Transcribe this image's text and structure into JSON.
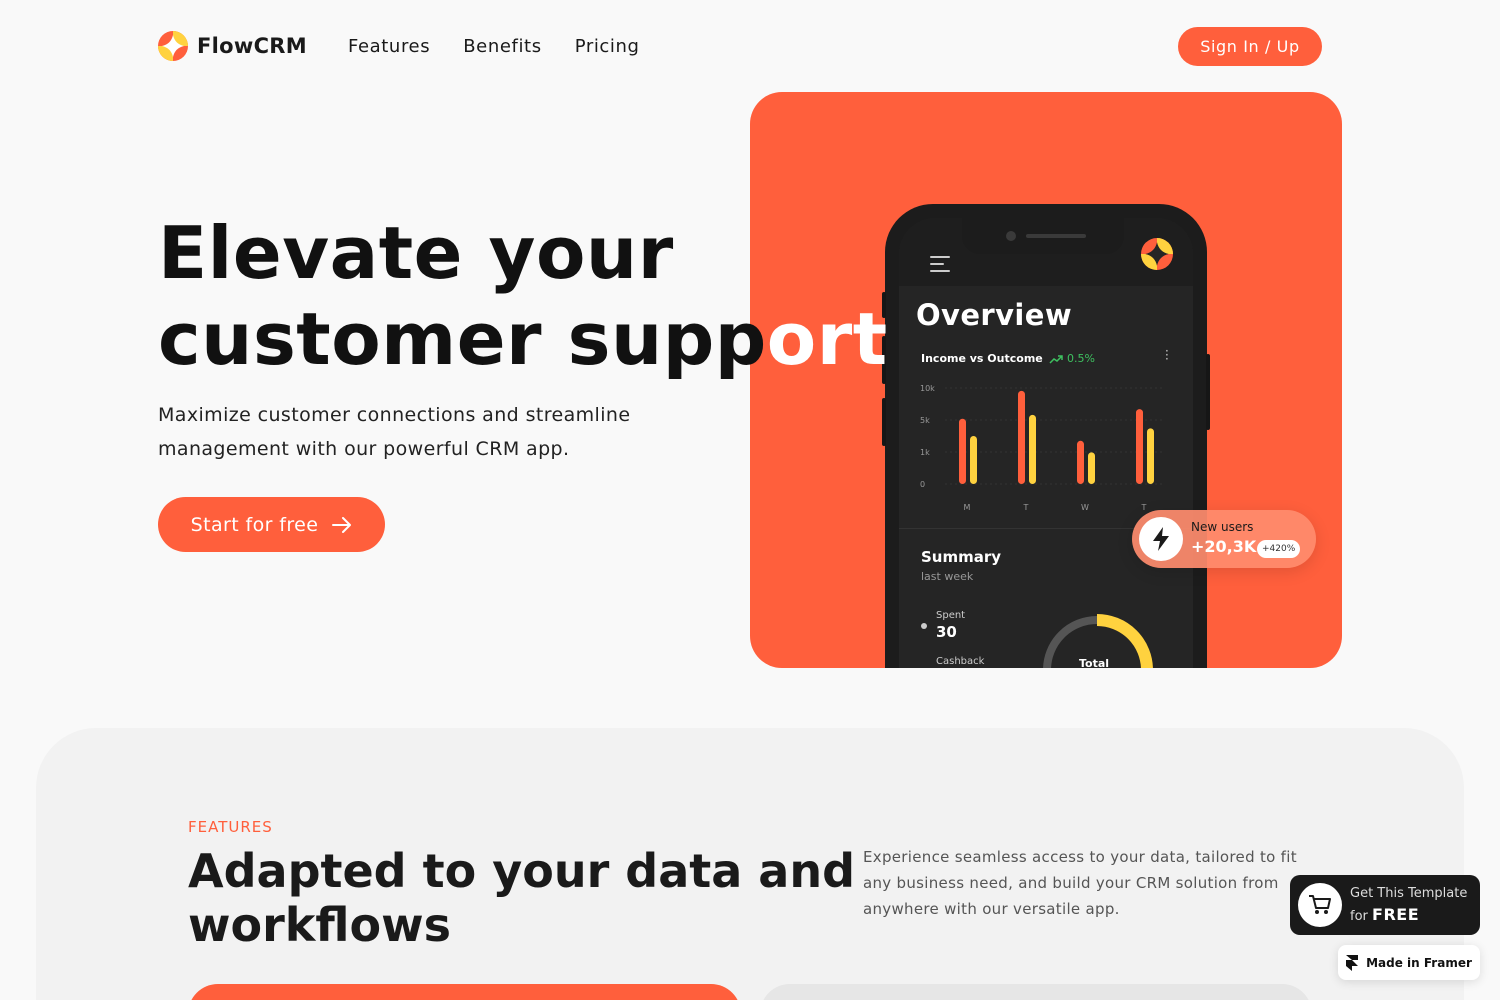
{
  "brand": {
    "name": "FlowCRM",
    "accent": "#ff5f3c",
    "accent_yellow": "#ffd23f"
  },
  "nav": {
    "links": [
      "Features",
      "Benefits",
      "Pricing"
    ],
    "signin_label": "Sign In / Up"
  },
  "hero": {
    "title_line1": "Elevate your",
    "title_line2_dark": "customer supp",
    "title_line2_white": "ort",
    "subtitle_line1": "Maximize customer connections and streamline",
    "subtitle_line2": "management with our powerful CRM app.",
    "cta_label": "Start for free"
  },
  "phone": {
    "overview": "Overview",
    "income_label": "Income vs Outcome",
    "income_change": "0.5%",
    "summary_title": "Summary",
    "summary_period": "last week",
    "spent_label": "Spent",
    "spent_value": "30",
    "cashback_label": "Cashback",
    "total_label": "Total"
  },
  "chart_data": {
    "type": "bar",
    "categories": [
      "M",
      "T",
      "W",
      "T"
    ],
    "yticks": [
      "10k",
      "5k",
      "1k",
      "0"
    ],
    "series": [
      {
        "color": "#ff5f3c",
        "values": [
          0.68,
          0.97,
          0.45,
          0.78
        ]
      },
      {
        "color": "#ffd23f",
        "values": [
          0.5,
          0.72,
          0.33,
          0.58
        ]
      }
    ]
  },
  "badge": {
    "label": "New users",
    "value": "+20,3K",
    "change": "+420%"
  },
  "features": {
    "eyebrow": "FEATURES",
    "title": "Adapted to your data and workflows",
    "description": "Experience seamless access to your data, tailored to fit any business need, and build your CRM solution from anywhere with our versatile app."
  },
  "template_promo": {
    "line1": "Get This Template",
    "line2_prefix": "for",
    "line2_bold": "FREE"
  },
  "framer": {
    "label": "Made in Framer"
  }
}
